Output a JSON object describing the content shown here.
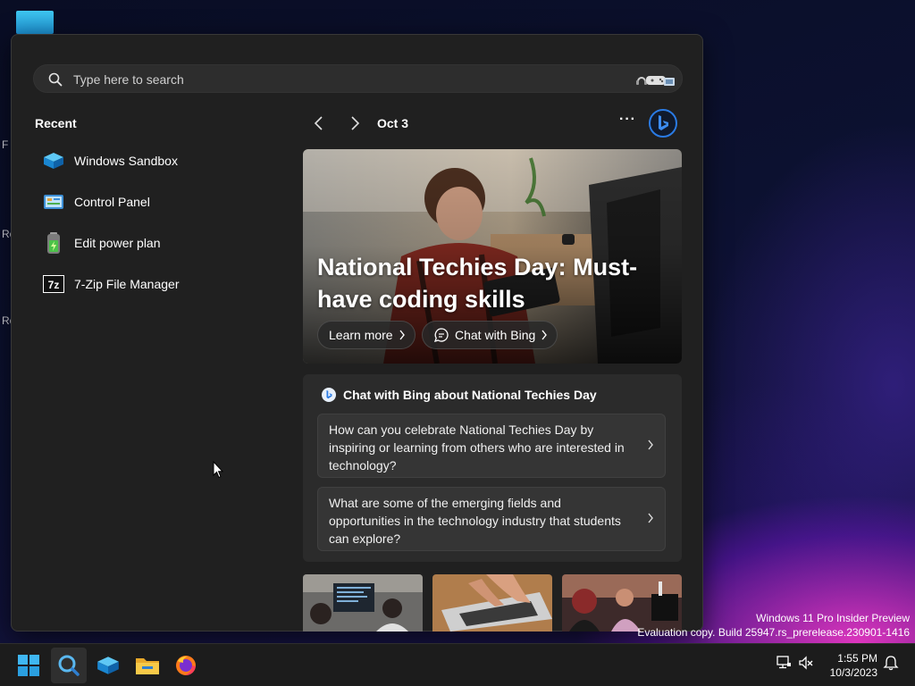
{
  "desktop": {
    "fragments": [
      "F",
      "Ro",
      "Ro"
    ]
  },
  "search": {
    "placeholder": "Type here to search",
    "icon": "search-icon"
  },
  "recent": {
    "title": "Recent",
    "apps": [
      {
        "label": "Windows Sandbox",
        "icon": "windows-sandbox-icon"
      },
      {
        "label": "Control Panel",
        "icon": "control-panel-icon"
      },
      {
        "label": "Edit power plan",
        "icon": "power-plan-icon"
      },
      {
        "label": "7-Zip File Manager",
        "icon": "7zip-icon",
        "icon_text": "7z"
      }
    ]
  },
  "highlights": {
    "date": "Oct 3",
    "more_label": "···",
    "hero": {
      "title": "National Techies Day: Must-have coding skills",
      "learn_more": "Learn more",
      "chat_with_bing": "Chat with Bing"
    },
    "chat": {
      "heading": "Chat with Bing about National Techies Day",
      "questions": [
        "How can you celebrate National Techies Day by inspiring or learning from others who are interested in technology?",
        "What are some of the emerging fields and opportunities in the technology industry that students can explore?"
      ]
    }
  },
  "watermark": {
    "line1": "Windows 11 Pro Insider Preview",
    "line2": "Evaluation copy. Build 25947.rs_prerelease.230901-1416"
  },
  "taskbar": {
    "apps": [
      "start-icon",
      "search-icon",
      "windows-sandbox-icon",
      "file-explorer-icon",
      "firefox-icon"
    ],
    "time": "1:55 PM",
    "date": "10/3/2023"
  },
  "colors": {
    "panel": "#202020",
    "card": "#2b2b2b",
    "accent": "#0078d4",
    "bing": "#2a7be4"
  }
}
